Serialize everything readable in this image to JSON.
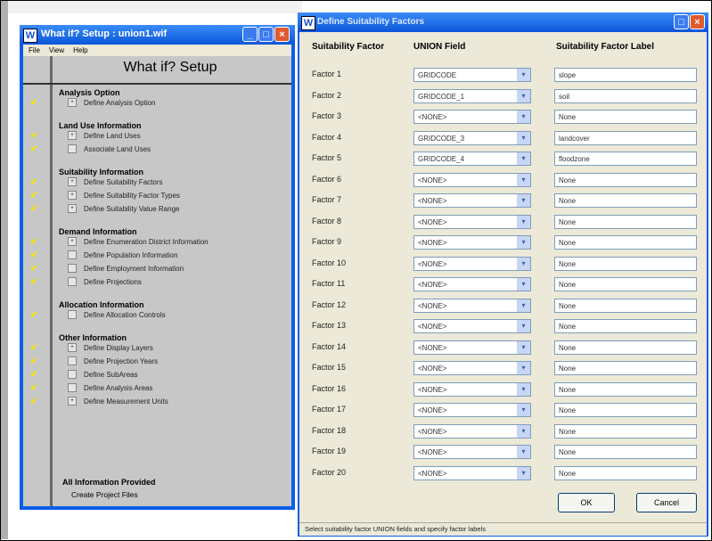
{
  "setup_window": {
    "title": "What if? Setup : union1.wif",
    "app_icon": "W",
    "menu": [
      "File",
      "View",
      "Help"
    ],
    "heading": "What if? Setup",
    "sections": [
      {
        "name": "Analysis Option",
        "items": [
          {
            "label": "Define Analysis Option",
            "checked": true,
            "box": "+"
          }
        ]
      },
      {
        "name": "Land Use Information",
        "items": [
          {
            "label": "Define Land Uses",
            "checked": true,
            "box": "+"
          },
          {
            "label": "Associate Land Uses",
            "checked": true,
            "box": ""
          }
        ]
      },
      {
        "name": "Suitability Information",
        "items": [
          {
            "label": "Define Suitability Factors",
            "checked": true,
            "box": "+"
          },
          {
            "label": "Define Suitability Factor Types",
            "checked": true,
            "box": "+"
          },
          {
            "label": "Define Suitability Value Range",
            "checked": true,
            "box": "+"
          }
        ]
      },
      {
        "name": "Demand Information",
        "items": [
          {
            "label": "Define Enumeration District Information",
            "checked": true,
            "box": "+"
          },
          {
            "label": "Define Population Information",
            "checked": true,
            "box": ""
          },
          {
            "label": "Define Employment Information",
            "checked": true,
            "box": ""
          },
          {
            "label": "Define Projections",
            "checked": true,
            "box": ""
          }
        ]
      },
      {
        "name": "Allocation Information",
        "items": [
          {
            "label": "Define Allocation Controls",
            "checked": true,
            "box": ""
          }
        ]
      },
      {
        "name": "Other Information",
        "items": [
          {
            "label": "Define Display Layers",
            "checked": true,
            "box": "+"
          },
          {
            "label": "Define Projection Years",
            "checked": true,
            "box": ""
          },
          {
            "label": "Define SubAreas",
            "checked": true,
            "box": ""
          },
          {
            "label": "Define Analysis Areas",
            "checked": true,
            "box": ""
          },
          {
            "label": "Define Measurement Units",
            "checked": true,
            "box": "+"
          }
        ]
      }
    ],
    "all_provided": "All Information Provided",
    "create_files": "Create Project Files"
  },
  "dialog": {
    "title": "Define Suitability Factors",
    "col_factor": "Suitability Factor",
    "col_field": "UNION Field",
    "col_label": "Suitability Factor Label",
    "rows": [
      {
        "factor": "Factor 1",
        "field": "GRIDCODE",
        "label": "slope"
      },
      {
        "factor": "Factor 2",
        "field": "GRIDCODE_1",
        "label": "soil"
      },
      {
        "factor": "Factor 3",
        "field": "<NONE>",
        "label": "None"
      },
      {
        "factor": "Factor 4",
        "field": "GRIDCODE_3",
        "label": "landcover"
      },
      {
        "factor": "Factor 5",
        "field": "GRIDCODE_4",
        "label": "floodzone"
      },
      {
        "factor": "Factor 6",
        "field": "<NONE>",
        "label": "None"
      },
      {
        "factor": "Factor 7",
        "field": "<NONE>",
        "label": "None"
      },
      {
        "factor": "Factor 8",
        "field": "<NONE>",
        "label": "None"
      },
      {
        "factor": "Factor 9",
        "field": "<NONE>",
        "label": "None"
      },
      {
        "factor": "Factor 10",
        "field": "<NONE>",
        "label": "None"
      },
      {
        "factor": "Factor 11",
        "field": "<NONE>",
        "label": "None"
      },
      {
        "factor": "Factor 12",
        "field": "<NONE>",
        "label": "None"
      },
      {
        "factor": "Factor 13",
        "field": "<NONE>",
        "label": "None"
      },
      {
        "factor": "Factor 14",
        "field": "<NONE>",
        "label": "None"
      },
      {
        "factor": "Factor 15",
        "field": "<NONE>",
        "label": "None"
      },
      {
        "factor": "Factor 16",
        "field": "<NONE>",
        "label": "None"
      },
      {
        "factor": "Factor 17",
        "field": "<NONE>",
        "label": "None"
      },
      {
        "factor": "Factor 18",
        "field": "<NONE>",
        "label": "None"
      },
      {
        "factor": "Factor 19",
        "field": "<NONE>",
        "label": "None"
      },
      {
        "factor": "Factor 20",
        "field": "<NONE>",
        "label": "None"
      }
    ],
    "ok": "OK",
    "cancel": "Cancel",
    "status": "Select suitability factor UNION fields and specify factor labels"
  },
  "icons": {
    "check": "checkmark-icon",
    "dropdown": "chevron-down-icon",
    "close": "close-icon",
    "minimize": "minimize-icon",
    "maximize": "maximize-icon"
  },
  "colors": {
    "titlebar": "#0a55d8",
    "client": "#ece9d8",
    "tree_panel": "#c7c7c7",
    "check": "#f5e400",
    "close_button": "#e15a2e"
  }
}
